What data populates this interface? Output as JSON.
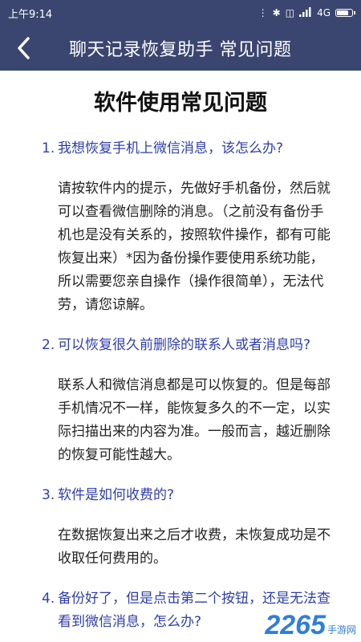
{
  "status_bar": {
    "time": "上午9:14",
    "network": "4G",
    "battery_level": 0.85
  },
  "nav": {
    "back_icon": "chevron-left-icon",
    "title": "聊天记录恢复助手 常见问题"
  },
  "page": {
    "heading": "软件使用常见问题",
    "faqs": [
      {
        "num": "1.",
        "question": "我想恢复手机上微信消息，该怎么办?",
        "answer": "请按软件内的提示，先做好手机备份，然后就可以查看微信删除的消息。（之前没有备份手机也是没有关系的，按照软件操作，都有可能恢复出来）*因为备份操作要使用系统功能，所以需要您亲自操作（操作很简单），无法代劳，请您谅解。"
      },
      {
        "num": "2.",
        "question": "可以恢复很久前删除的联系人或者消息吗?",
        "answer": "联系人和微信消息都是可以恢复的。但是每部手机情况不一样，能恢复多久的不一定，以实际扫描出来的内容为准。一般而言，越近删除的恢复可能性越大。"
      },
      {
        "num": "3.",
        "question": "软件是如何收费的?",
        "answer": "在数据恢复出来之后才收费，未恢复成功是不收取任何费用的。"
      },
      {
        "num": "4.",
        "question": "备份好了，但是点击第二个按钮，还是无法查看到微信消息，怎么办?",
        "answer": ""
      }
    ]
  },
  "watermark": {
    "logo": "2265",
    "site": "手游网"
  },
  "colors": {
    "header_bg": "#3b4670",
    "question": "#2e3eae",
    "answer": "#222222"
  }
}
